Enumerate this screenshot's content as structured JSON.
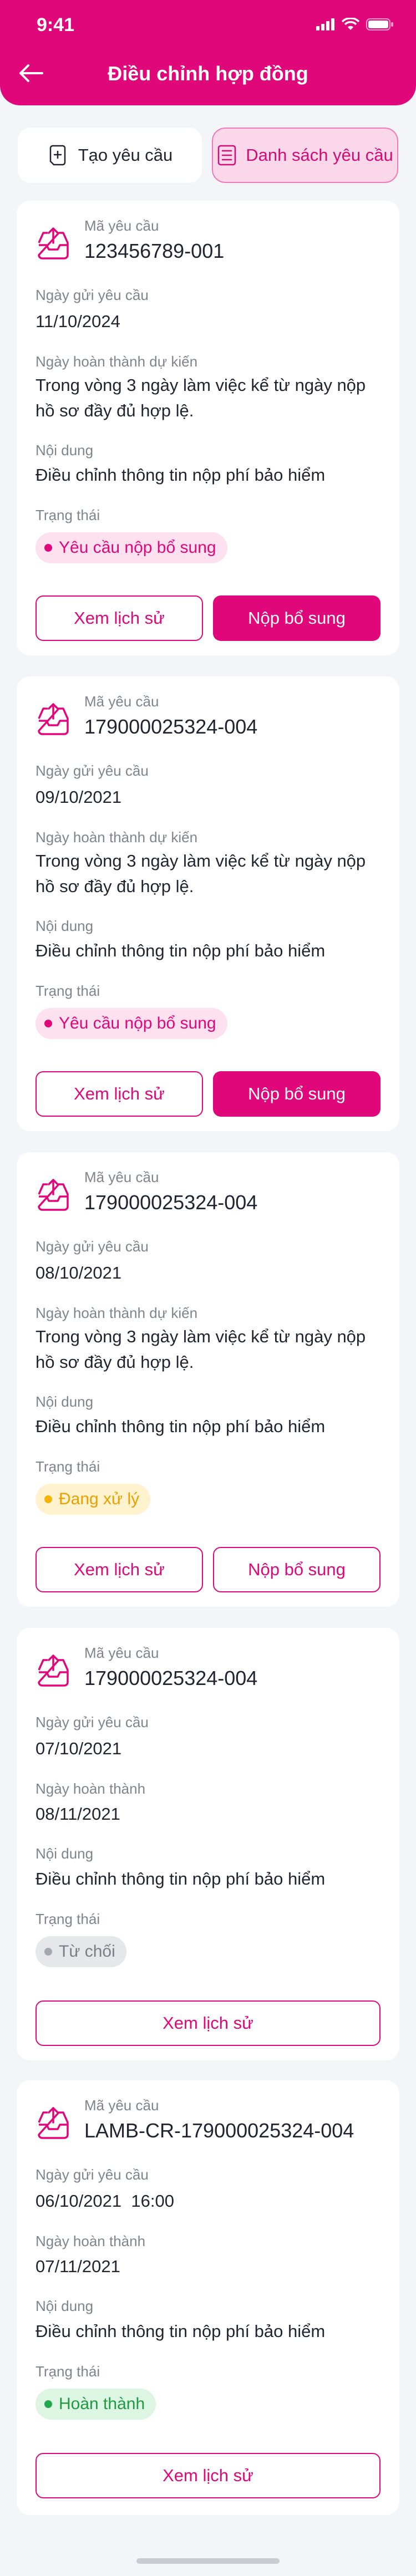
{
  "status_bar": {
    "time": "9:41"
  },
  "header": {
    "title": "Điều chỉnh hợp đồng"
  },
  "tabs": [
    {
      "label": "Tạo yêu cầu",
      "icon": "add-document-icon",
      "active": false
    },
    {
      "label": "Danh sách yêu cầu",
      "icon": "list-icon",
      "active": true
    }
  ],
  "colors": {
    "brand": "#e0077a",
    "brand_light": "#fbd7ea",
    "pending": "#f5b400",
    "rejected": "#a4a8b0",
    "done": "#20a84a"
  },
  "labels": {
    "request_code": "Mã yêu cầu",
    "sent_date": "Ngày gửi yêu cầu",
    "expected_completion": "Ngày hoàn thành dự kiến",
    "completion": "Ngày hoàn thành",
    "content": "Nội dung",
    "status": "Trạng thái",
    "history_button": "Xem lịch sử",
    "supplement_button": "Nộp bổ sung"
  },
  "requests": [
    {
      "code": "123456789-001",
      "sent_date": "11/10/2024",
      "completion": "Trong vòng 3 ngày làm việc kể từ ngày nộp hồ sơ đầy đủ hợp lệ.",
      "content": "Điều chỉnh thông tin nộp phí bảo hiểm",
      "status": "Yêu cầu nộp bổ sung"
    },
    {
      "code": "179000025324-004",
      "sent_date": "09/10/2021",
      "completion": "Trong vòng 3 ngày làm việc kể từ ngày nộp hồ sơ đầy đủ hợp lệ.",
      "content": "Điều chỉnh thông tin nộp phí bảo hiểm",
      "status": "Yêu cầu nộp bổ sung"
    },
    {
      "code": "179000025324-004",
      "sent_date": "08/10/2021",
      "completion": "Trong vòng 3 ngày làm việc kể từ ngày nộp hồ sơ đầy đủ hợp lệ.",
      "content": "Điều chỉnh thông tin nộp phí bảo hiểm",
      "status": "Đang xử lý"
    },
    {
      "code": "179000025324-004",
      "sent_date": "07/10/2021",
      "completion": "08/11/2021",
      "content": "Điều chỉnh thông tin nộp phí bảo hiểm",
      "status": "Từ chối"
    },
    {
      "code": "LAMB-CR-179000025324-004",
      "sent_date": "06/10/2021  16:00",
      "completion": "07/11/2021",
      "content": "Điều chỉnh thông tin nộp phí bảo hiểm",
      "status": "Hoàn thành"
    }
  ]
}
